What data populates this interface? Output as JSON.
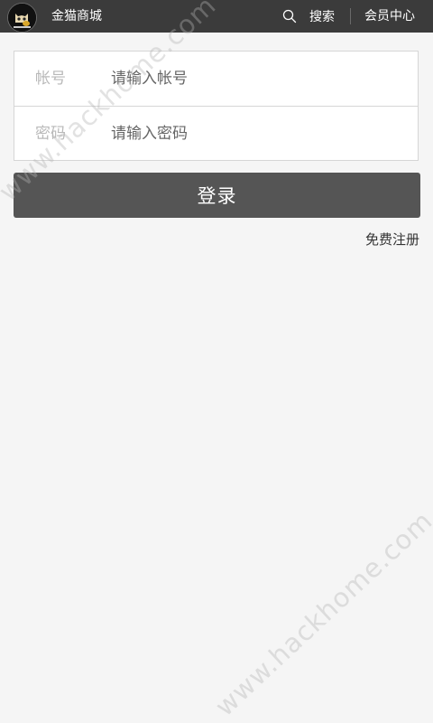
{
  "header": {
    "app_title": "金猫商城",
    "search_label": "搜索",
    "member_center_label": "会员中心",
    "background_color": "#3b3b3b"
  },
  "login_form": {
    "account_label": "帐号",
    "account_placeholder": "请输入帐号",
    "account_value": "",
    "password_label": "密码",
    "password_placeholder": "请输入密码",
    "password_value": ""
  },
  "actions": {
    "login_label": "登录",
    "register_label": "免费注册",
    "button_color": "#555555"
  },
  "watermark": {
    "text": "www.hackhome.com"
  }
}
